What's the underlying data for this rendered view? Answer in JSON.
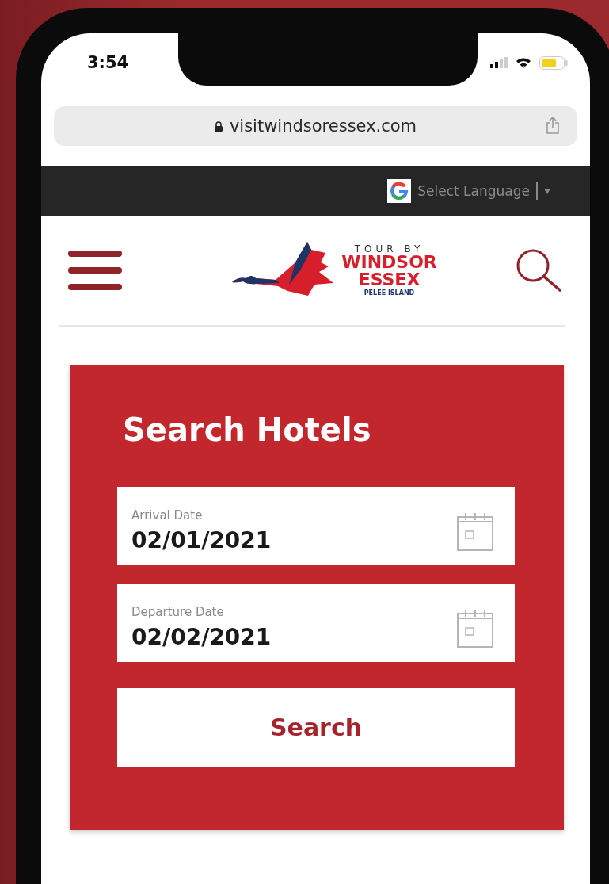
{
  "status_bar": {
    "time": "3:54"
  },
  "browser": {
    "url": "visitwindsoressex.com"
  },
  "translate_bar": {
    "label": "Select Language"
  },
  "header": {
    "logo": {
      "line_1": "TOUR BY",
      "line_2": "WINDSOR",
      "line_3": "ESSEX",
      "line_4": "PELEE ISLAND"
    }
  },
  "search_card": {
    "title": "Search Hotels",
    "fields": [
      {
        "label": "Arrival Date",
        "value": "02/01/2021"
      },
      {
        "label": "Departure Date",
        "value": "02/02/2021"
      }
    ],
    "button": "Search"
  }
}
